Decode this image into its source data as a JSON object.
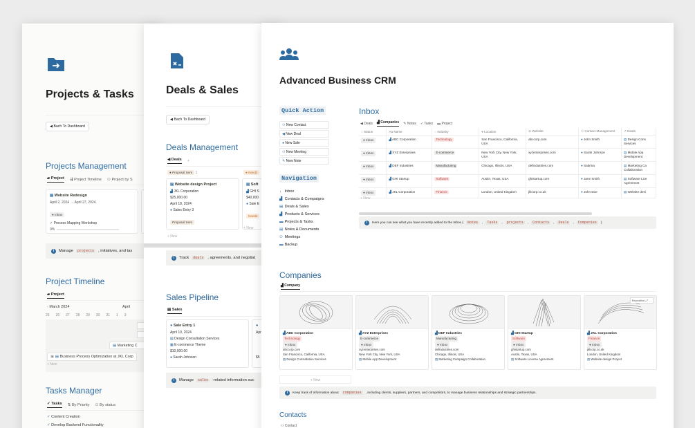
{
  "projects_page": {
    "title": "Projects & Tasks",
    "back_button": "Bach To Dashboard",
    "projects_management": {
      "title": "Projects Management",
      "tabs": [
        "Project",
        "Project Timeline",
        "Project by S"
      ],
      "card": {
        "name": "Website Redesign",
        "dates": "April 2, 2024 → April 27, 2024",
        "status": "Inbox",
        "task": "Process Mapping Workshop",
        "progress_label": "0%",
        "progress": 0
      }
    },
    "callout": {
      "before": "Manage",
      "code": "projects",
      "after": ", initiatives, and tas"
    },
    "timeline": {
      "title": "Project Timeline",
      "tab": "Project",
      "month_a": "March 2024",
      "month_b": "April",
      "days": [
        "25",
        "26",
        "27",
        "28",
        "29",
        "30",
        "31",
        "1",
        "3"
      ],
      "bar_label": "Marketing C",
      "row_label": "Business Process Optimization at JKL Corp",
      "new_label": "+ New"
    },
    "tasks": {
      "title": "Tasks Manager",
      "tabs": [
        "Tasks",
        "By Priority",
        "By status"
      ],
      "items": [
        "Content Creation",
        "Develop Backend Functionality"
      ]
    }
  },
  "deals_page": {
    "title": "Deals & Sales",
    "back_button": "Bach To Dashboard",
    "deals_management": {
      "title": "Deals Management",
      "tab": "Deals",
      "col_a": {
        "label": "Proposal Sent",
        "count": "1"
      },
      "col_b": {
        "label": "Needs"
      },
      "card": {
        "name": "Website design Project",
        "company": "JKL Corporation",
        "amount": "$25,000.00",
        "date": "April 18, 2024",
        "entry": "Sales Entry 3",
        "status": "Proposal Sent"
      },
      "card_b": {
        "name": "Soft",
        "company": "GHI S",
        "amount": "$40,000",
        "entry": "Sale E",
        "status": "Needs"
      },
      "new_label": "+ New"
    },
    "callout": {
      "before": "Track",
      "code": "deals",
      "after": ", agreements, and negotiat"
    },
    "pipeline": {
      "title": "Sales Pipeline",
      "tab": "Sales",
      "card": {
        "name": "Sale Entry 1",
        "date": "April 10, 2024",
        "service": "Design Consultation Services",
        "theme": "E-commerce Theme",
        "amount": "$10,000.00",
        "person": "Sarah Johnson"
      },
      "card_b": {
        "date": "Apr",
        "amount": "$5"
      }
    },
    "callout2": {
      "before": "Manage",
      "code": "sales",
      "after": "-related information suc"
    }
  },
  "crm_page": {
    "title": "Advanced Business CRM",
    "quick_action": {
      "title": "Quick Action",
      "buttons": [
        "New Contact",
        "New Deal",
        "New Sale",
        "New Meeting",
        "New Note"
      ]
    },
    "navigation": {
      "title": "Navigation",
      "items": [
        "Inbox",
        "Contacts & Compaigns",
        "Deals & Sales",
        "Products & Services",
        "Projects & Tasks",
        "Notes & Documents",
        "Meetings",
        "Backup"
      ]
    },
    "inbox": {
      "title": "Inbox",
      "tabs": [
        "Deals",
        "Companies",
        "Notes",
        "Tasks",
        "Project"
      ],
      "columns": [
        "Status",
        "Name",
        "Industry",
        "Location",
        "Website",
        "Contact Management",
        "Deals"
      ],
      "rows": [
        {
          "status": "Inbox",
          "name": "ABC Corporation",
          "industry": "Technology",
          "location": "San Francisco, California, USA",
          "website": "abccorp.com",
          "contact": "John Smith",
          "deal": "Design Cons Services"
        },
        {
          "status": "Inbox",
          "name": "XYZ Enterprises",
          "industry": "E-commerce",
          "location": "New York City, New York, USA",
          "website": "xyzenterprises.com",
          "contact": "Sarah Johnson",
          "deal": "Mobile App Development"
        },
        {
          "status": "Inbox",
          "name": "DEF Industries",
          "industry": "Manufacturing",
          "location": "Chicago, Illinois, USA",
          "website": "defindustries.com",
          "contact": "Sabrina",
          "deal": "Marketing Ca Collaboration"
        },
        {
          "status": "Inbox",
          "name": "GHI Startup",
          "industry": "Software",
          "location": "Austin, Texas, USA",
          "website": "ghistartup.com",
          "contact": "Jane Smith",
          "deal": "Software Lice Agreement"
        },
        {
          "status": "Inbox",
          "name": "JKL Corporation",
          "industry": "Finance",
          "location": "London, United Kingdom",
          "website": "jklcorp.co.uk",
          "contact": "John Doe",
          "deal": "Website desi"
        }
      ],
      "new_label": "+ New",
      "callout": {
        "text": "Here you can see what you have recently added to the Inbox (",
        "codes": [
          "Notes",
          "Tasks",
          "projects",
          "Contacts",
          "Deals",
          "Companies"
        ],
        "end": ")"
      }
    },
    "companies": {
      "title": "Companies",
      "tab": "Company",
      "cards": [
        {
          "name": "ABC Corporation",
          "industry": "Technology",
          "status": "Inbox",
          "website": "abccorp.com",
          "location": "San Francisco, California, USA",
          "deal": "Design Consultation Services"
        },
        {
          "name": "XYZ Enterprises",
          "industry": "E-commerce",
          "status": "Inbox",
          "website": "xyzenterprises.com",
          "location": "New York City, New York, USA",
          "deal": "Mobile App Development"
        },
        {
          "name": "DEF Industries",
          "industry": "Manufacturing",
          "status": "Inbox",
          "website": "defindustries.com",
          "location": "Chicago, Illinois, USA",
          "deal": "Marketing Campaign Collaboration"
        },
        {
          "name": "GHI Startup",
          "industry": "Software",
          "status": "Inbox",
          "website": "ghistartup.com",
          "location": "Austin, Texas, USA",
          "deal": "Software License Agreement"
        },
        {
          "name": "JKL Corporation",
          "industry": "Finance",
          "status": "Inbox",
          "website": "jklcorp.co.uk",
          "location": "London, United Kingdom",
          "deal": "Website design Project"
        }
      ],
      "reposition_label": "Reposition",
      "new_label": "+ New",
      "callout": {
        "before": "Keep track of information about",
        "code": "companies",
        "after": ", including clients, suppliers, partners, and competitors, to manage business relationships and strategic partnerships."
      }
    },
    "contacts": {
      "title": "Contacts",
      "tab": "Contact"
    }
  },
  "colors": {
    "accent": "#2d6a9f",
    "tag_red": "#fbe4e4",
    "tag_red_text": "#b4493f",
    "tag_gray": "#eeeeec"
  }
}
